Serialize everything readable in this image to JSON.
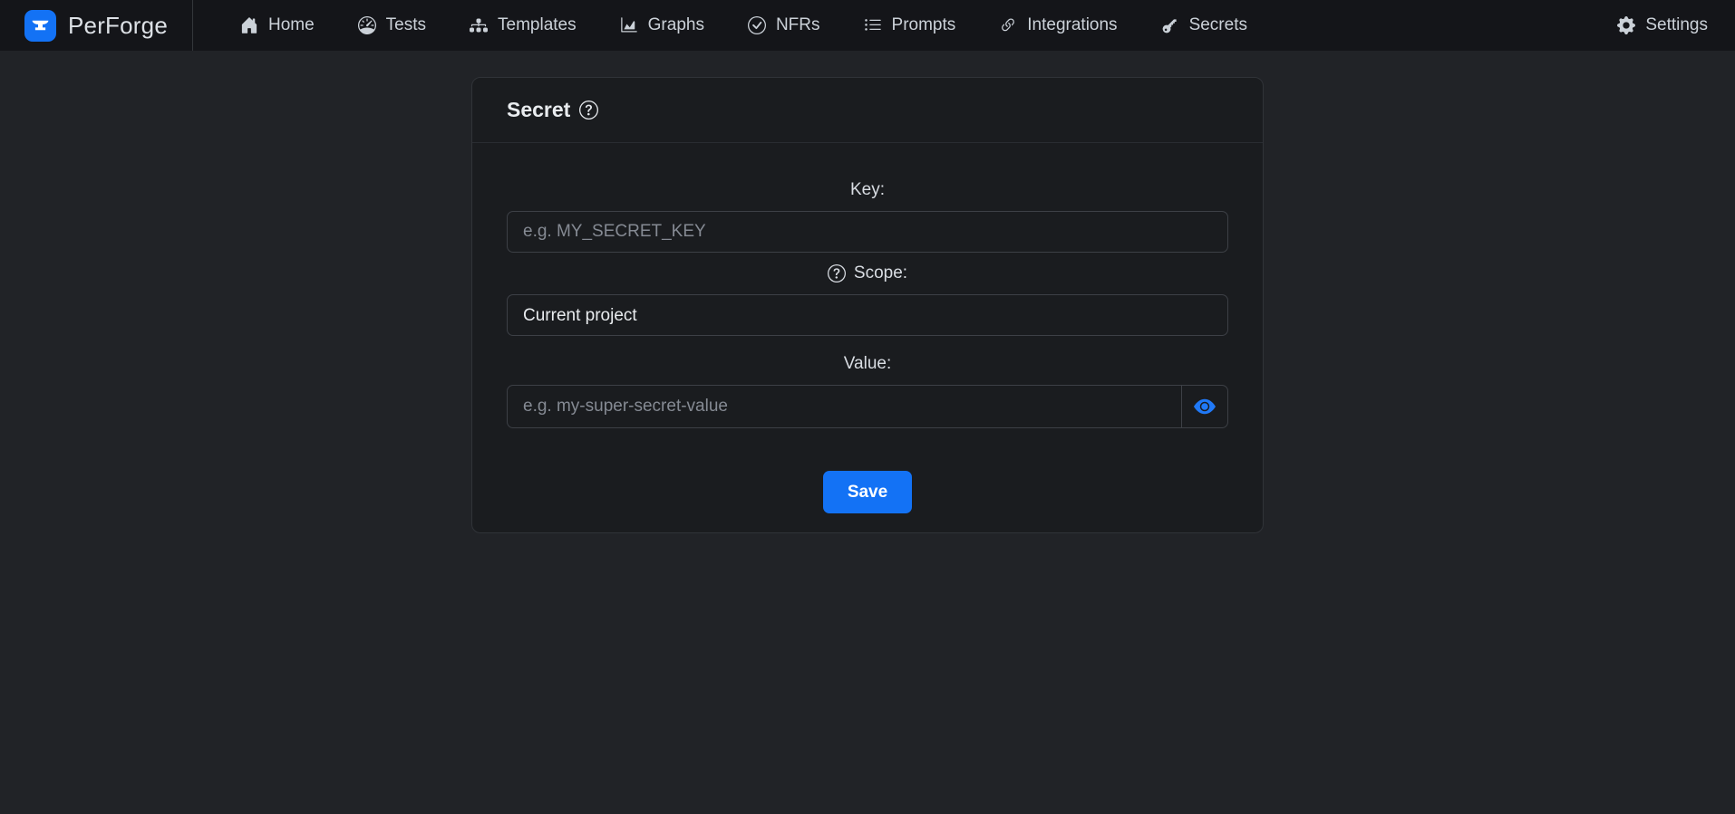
{
  "navbar": {
    "brand": "PerForge",
    "items": [
      {
        "label": "Home",
        "icon": "home-icon"
      },
      {
        "label": "Tests",
        "icon": "speedometer-icon"
      },
      {
        "label": "Templates",
        "icon": "diagram-icon"
      },
      {
        "label": "Graphs",
        "icon": "chart-icon"
      },
      {
        "label": "NFRs",
        "icon": "check-circle-icon"
      },
      {
        "label": "Prompts",
        "icon": "list-icon"
      },
      {
        "label": "Integrations",
        "icon": "link-icon"
      },
      {
        "label": "Secrets",
        "icon": "key-icon"
      }
    ],
    "settings": {
      "label": "Settings",
      "icon": "gear-icon"
    }
  },
  "secret_card": {
    "title": "Secret",
    "key_field": {
      "label": "Key:",
      "placeholder": "e.g. MY_SECRET_KEY",
      "value": ""
    },
    "scope_field": {
      "label": "Scope:",
      "selected": "Current project"
    },
    "value_field": {
      "label": "Value:",
      "placeholder": "e.g. my-super-secret-value",
      "value": ""
    },
    "save_button": "Save"
  },
  "colors": {
    "accent_blue": "#1372f5",
    "eye_icon_blue": "#2079f7",
    "navbar_bg": "#141519",
    "page_bg": "#212327",
    "card_bg": "#1a1c1f"
  }
}
